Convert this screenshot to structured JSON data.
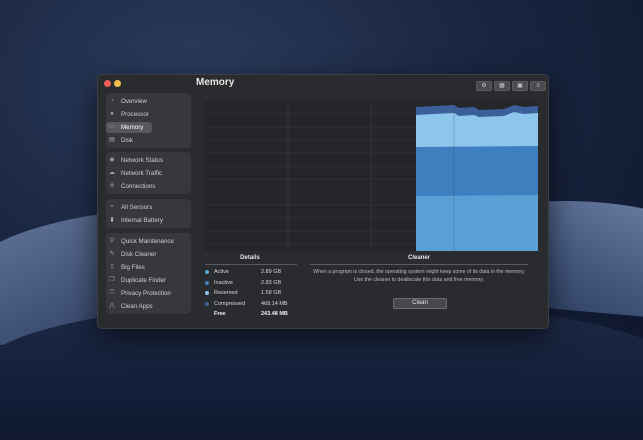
{
  "window": {
    "title": "Memory"
  },
  "toolbar": {
    "icons": [
      "gear-icon",
      "calendar-icon",
      "windows-icon",
      "list-icon"
    ]
  },
  "sidebar": {
    "groups": [
      {
        "items": [
          {
            "label": "Overview",
            "icon": "clock-icon"
          },
          {
            "label": "Processor",
            "icon": "cpu-icon"
          },
          {
            "label": "Memory",
            "icon": "memory-icon",
            "selected": true
          },
          {
            "label": "Disk",
            "icon": "disk-icon"
          }
        ]
      },
      {
        "items": [
          {
            "label": "Network Status",
            "icon": "network-status-icon"
          },
          {
            "label": "Network Traffic",
            "icon": "cloud-icon"
          },
          {
            "label": "Connections",
            "icon": "connections-icon"
          }
        ]
      },
      {
        "items": [
          {
            "label": "All Sensors",
            "icon": "sensor-icon"
          },
          {
            "label": "Internal Battery",
            "icon": "battery-icon"
          }
        ]
      },
      {
        "items": [
          {
            "label": "Quick Maintenance",
            "icon": "maintenance-icon"
          },
          {
            "label": "Disk Cleaner",
            "icon": "broom-icon"
          },
          {
            "label": "Big Files",
            "icon": "file-icon"
          },
          {
            "label": "Duplicate Finder",
            "icon": "duplicate-icon"
          },
          {
            "label": "Privacy Protection",
            "icon": "shield-icon"
          },
          {
            "label": "Clean Apps",
            "icon": "apps-icon"
          }
        ]
      }
    ]
  },
  "details": {
    "title": "Details",
    "rows": [
      {
        "label": "Active",
        "value": "2.89 GB",
        "color": "#5aa7e0"
      },
      {
        "label": "Inactive",
        "value": "2.83 GB",
        "color": "#3f7fbf"
      },
      {
        "label": "Reserved",
        "value": "1.59 GB",
        "color": "#8cc6ec"
      },
      {
        "label": "Compressed",
        "value": "468.14 MB",
        "color": "#3a5f99"
      },
      {
        "label": "Free",
        "value": "243.48 MB",
        "color": ""
      }
    ]
  },
  "cleaner": {
    "title": "Cleaner",
    "text": "When a program is closed, the operating system might keep some of its data in the memory. Use the cleaner to deallocate this data and  free memory.",
    "button_label": "Clean"
  },
  "colors": {
    "active": "#5aa7e0",
    "inactive": "#3f7fbf",
    "reserved": "#8cc6ec",
    "compressed": "#3a5f99"
  }
}
